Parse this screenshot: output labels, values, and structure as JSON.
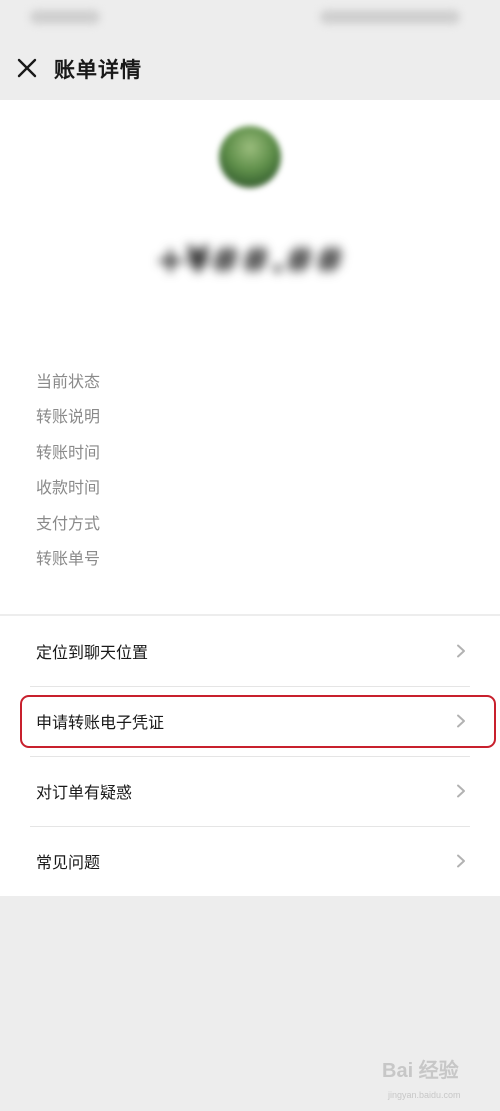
{
  "status_bar": {
    "left_text": "",
    "right_text": ""
  },
  "nav": {
    "title": "账单详情",
    "close_icon": "close-icon"
  },
  "summary": {
    "avatar_icon": "avatar-image",
    "payee_name": "",
    "amount": "+¥##.##"
  },
  "info_rows": [
    {
      "label": "当前状态",
      "value": ""
    },
    {
      "label": "转账说明",
      "value": ""
    },
    {
      "label": "转账时间",
      "value": ""
    },
    {
      "label": "收款时间",
      "value": ""
    },
    {
      "label": "支付方式",
      "value": ""
    },
    {
      "label": "转账单号",
      "value": ""
    }
  ],
  "actions": [
    {
      "label": "定位到聊天位置",
      "icon": "chevron-right-icon"
    },
    {
      "label": "申请转账电子凭证",
      "icon": "chevron-right-icon",
      "highlighted": true
    },
    {
      "label": "对订单有疑惑",
      "icon": "chevron-right-icon"
    },
    {
      "label": "常见问题",
      "icon": "chevron-right-icon"
    }
  ],
  "watermark": {
    "main": "Bai 经验",
    "sub": "jingyan.baidu.com"
  },
  "colors": {
    "highlight_border": "#c8202d",
    "page_bg": "#ededed",
    "card_bg": "#ffffff"
  }
}
